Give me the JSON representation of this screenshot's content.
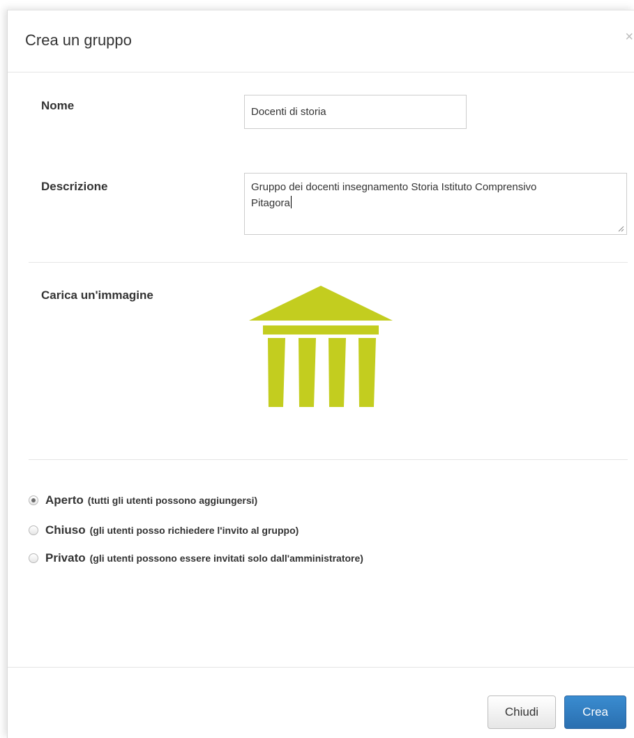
{
  "modal": {
    "title": "Crea un gruppo",
    "close_glyph": "×"
  },
  "form": {
    "name_label": "Nome",
    "name_value": "Docenti di storia",
    "description_label": "Descrizione",
    "description_value": "Gruppo dei docenti insegnamento Storia Istituto Comprensivo\nPitagora",
    "image_label": "Carica un'immagine",
    "image_icon": "temple-icon",
    "image_color": "#c3cd1f"
  },
  "visibility": {
    "selected": "aperto",
    "options": [
      {
        "title": "Aperto",
        "desc": "(tutti gli utenti possono aggiungersi)"
      },
      {
        "title": "Chiuso",
        "desc": "(gli utenti posso richiedere l'invito al gruppo)"
      },
      {
        "title": "Privato",
        "desc": "(gli utenti possono essere invitati solo dall'amministratore)"
      }
    ]
  },
  "footer": {
    "close_label": "Chiudi",
    "create_label": "Crea",
    "primary_color": "#337ab7"
  }
}
